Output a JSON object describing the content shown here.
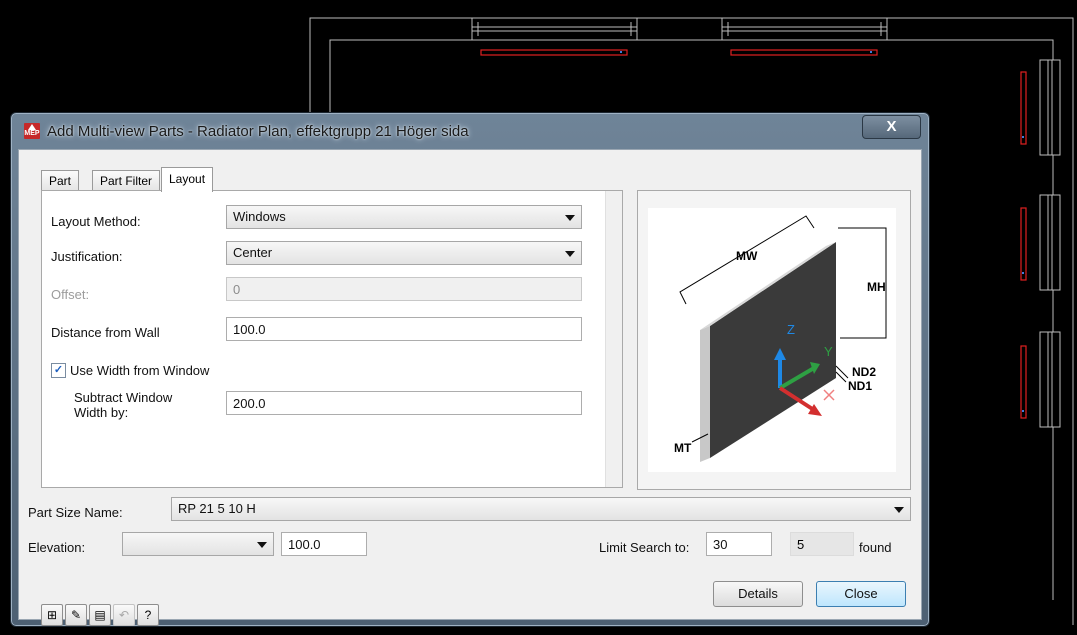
{
  "window": {
    "title": "Add Multi-view Parts - Radiator Plan, effektgrupp 21 Höger sida",
    "app_icon_text": "MEP",
    "close_glyph": "X"
  },
  "tabs": [
    {
      "label": "Part",
      "active": false
    },
    {
      "label": "Part Filter",
      "active": false
    },
    {
      "label": "Layout",
      "active": true
    }
  ],
  "layout": {
    "layout_method": {
      "label": "Layout Method:",
      "value": "Windows"
    },
    "justification": {
      "label": "Justification:",
      "value": "Center"
    },
    "offset": {
      "label": "Offset:",
      "value": "0"
    },
    "distance_from_wall": {
      "label": "Distance from Wall",
      "value": "100.0"
    },
    "use_width_from_window": {
      "label": "Use Width from Window",
      "checked": true,
      "check_glyph": "✓"
    },
    "subtract_window_width": {
      "label_line1": "Subtract Window",
      "label_line2": "Width by:",
      "value": "200.0"
    }
  },
  "preview": {
    "labels": {
      "mw": "MW",
      "mh": "MH",
      "nd2": "ND2",
      "nd1": "ND1",
      "mt": "MT",
      "z": "Z",
      "y": "Y",
      "x": "X"
    },
    "colors": {
      "panel": "#3a3a3a",
      "edge": "#c8c8c8",
      "z_axis": "#1e88e5",
      "y_axis": "#2ea043",
      "x_axis": "#d32f2f"
    }
  },
  "part_size": {
    "label": "Part Size Name:",
    "value": "RP 21 5  10 H"
  },
  "elevation": {
    "label": "Elevation:",
    "combo_value": "",
    "value": "100.0"
  },
  "search": {
    "label": "Limit Search to:",
    "limit": "30",
    "found_count": "5",
    "found_label": "found"
  },
  "buttons": {
    "details": "Details",
    "close": "Close"
  },
  "toolbar": [
    {
      "name": "part-catalog-icon",
      "glyph": "⊞"
    },
    {
      "name": "match-properties-brush-icon",
      "glyph": "✎"
    },
    {
      "name": "properties-icon",
      "glyph": "▤"
    },
    {
      "name": "undo-icon",
      "glyph": "↶"
    },
    {
      "name": "help-icon",
      "glyph": "?"
    }
  ],
  "colors": {
    "drawing_lines": "#bdbdbd",
    "radiator_outline": "#e02020",
    "cad_background": "#000000"
  }
}
